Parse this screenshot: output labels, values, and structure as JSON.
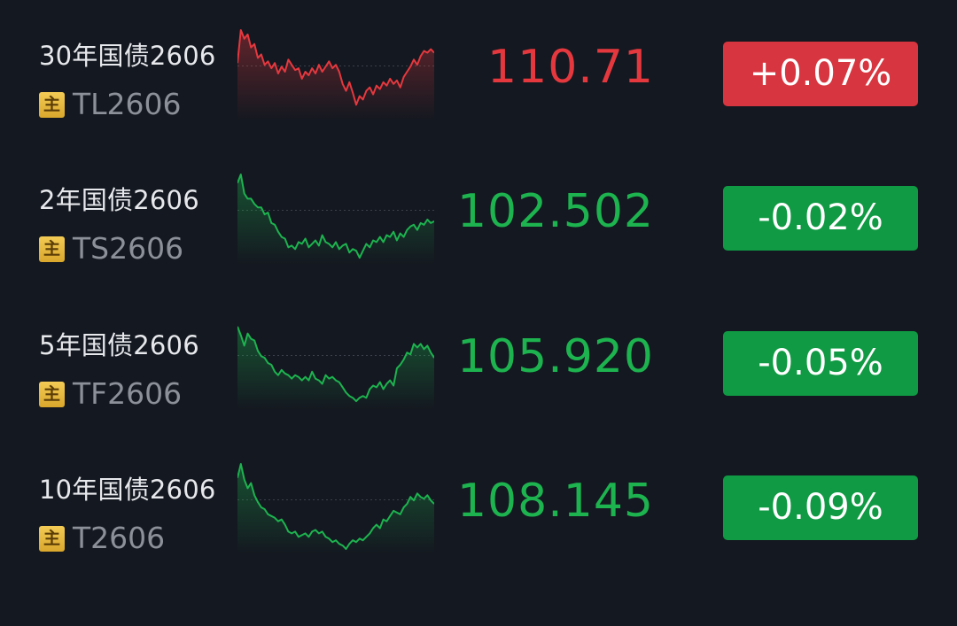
{
  "colors": {
    "background": "#141820",
    "up": "#e5383e",
    "down": "#1db34f",
    "up_badge": "#d7353f",
    "down_badge": "#0f9a43",
    "main_tag": "#eec04a"
  },
  "quotes": [
    {
      "name": "30年国债2606",
      "main_tag": "主",
      "code": "TL2606",
      "price": "110.71",
      "change": "+0.07%",
      "direction": "up",
      "spark": [
        0.62,
        1.0,
        0.9,
        0.95,
        0.8,
        0.84,
        0.68,
        0.72,
        0.6,
        0.64,
        0.56,
        0.62,
        0.5,
        0.58,
        0.52,
        0.66,
        0.6,
        0.54,
        0.56,
        0.44,
        0.52,
        0.48,
        0.56,
        0.5,
        0.6,
        0.52,
        0.58,
        0.64,
        0.56,
        0.6,
        0.52,
        0.38,
        0.3,
        0.4,
        0.28,
        0.14,
        0.24,
        0.2,
        0.3,
        0.34,
        0.26,
        0.36,
        0.32,
        0.4,
        0.36,
        0.44,
        0.38,
        0.42,
        0.34,
        0.46,
        0.52,
        0.58,
        0.66,
        0.6,
        0.7,
        0.76,
        0.74,
        0.78,
        0.74
      ]
    },
    {
      "name": "2年国债2606",
      "main_tag": "主",
      "code": "TS2606",
      "price": "102.502",
      "change": "-0.02%",
      "direction": "down",
      "spark": [
        0.9,
        1.0,
        0.78,
        0.72,
        0.72,
        0.66,
        0.62,
        0.62,
        0.54,
        0.56,
        0.44,
        0.42,
        0.34,
        0.28,
        0.26,
        0.16,
        0.18,
        0.14,
        0.22,
        0.2,
        0.26,
        0.16,
        0.2,
        0.24,
        0.18,
        0.3,
        0.22,
        0.2,
        0.16,
        0.22,
        0.14,
        0.18,
        0.2,
        0.1,
        0.14,
        0.12,
        0.04,
        0.12,
        0.2,
        0.16,
        0.24,
        0.22,
        0.28,
        0.22,
        0.3,
        0.28,
        0.34,
        0.24,
        0.32,
        0.28,
        0.36,
        0.4,
        0.42,
        0.36,
        0.44,
        0.42,
        0.48,
        0.44,
        0.46
      ]
    },
    {
      "name": "5年国债2606",
      "main_tag": "主",
      "code": "TF2606",
      "price": "105.920",
      "change": "-0.05%",
      "direction": "down",
      "spark": [
        0.92,
        0.82,
        0.7,
        0.84,
        0.78,
        0.76,
        0.64,
        0.58,
        0.56,
        0.5,
        0.48,
        0.4,
        0.36,
        0.42,
        0.38,
        0.36,
        0.32,
        0.36,
        0.34,
        0.3,
        0.34,
        0.3,
        0.4,
        0.32,
        0.3,
        0.26,
        0.36,
        0.32,
        0.34,
        0.3,
        0.28,
        0.22,
        0.16,
        0.12,
        0.1,
        0.06,
        0.1,
        0.12,
        0.1,
        0.2,
        0.24,
        0.22,
        0.28,
        0.2,
        0.26,
        0.3,
        0.24,
        0.44,
        0.48,
        0.54,
        0.62,
        0.6,
        0.72,
        0.68,
        0.72,
        0.66,
        0.7,
        0.62,
        0.56
      ]
    },
    {
      "name": "10年国债2606",
      "main_tag": "主",
      "code": "T2606",
      "price": "108.145",
      "change": "-0.09%",
      "direction": "down",
      "spark": [
        0.84,
        1.0,
        0.82,
        0.72,
        0.78,
        0.64,
        0.56,
        0.5,
        0.48,
        0.42,
        0.4,
        0.38,
        0.34,
        0.36,
        0.3,
        0.22,
        0.2,
        0.22,
        0.16,
        0.18,
        0.2,
        0.16,
        0.22,
        0.24,
        0.2,
        0.22,
        0.16,
        0.14,
        0.1,
        0.12,
        0.08,
        0.06,
        0.02,
        0.08,
        0.12,
        0.1,
        0.14,
        0.12,
        0.16,
        0.2,
        0.26,
        0.3,
        0.26,
        0.36,
        0.34,
        0.4,
        0.46,
        0.44,
        0.42,
        0.5,
        0.54,
        0.62,
        0.58,
        0.66,
        0.62,
        0.6,
        0.64,
        0.58,
        0.54
      ]
    }
  ]
}
